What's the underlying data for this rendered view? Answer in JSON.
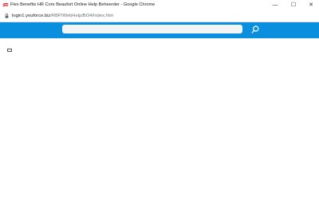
{
  "window": {
    "title": "Flex Benefits HR Core Beaufort Online Help Beheerder - Google Chrome",
    "app_icon": "brand-logo-icon",
    "controls": {
      "minimize_icon": "minimize-icon",
      "maximize_icon": "maximize-icon",
      "close_icon": "close-icon",
      "minimize_glyph": "—",
      "maximize_glyph": "☐",
      "close_glyph": "✕"
    }
  },
  "addressbar": {
    "lock_icon": "lock-icon",
    "url_host": "login1.youforce.biz",
    "url_path": "/RBP/WebHelp/BO4/index.htm"
  },
  "header": {
    "background_color": "#0a8fdf",
    "search": {
      "value": "",
      "placeholder": ""
    },
    "search_button_icon": "search-icon"
  },
  "content": {
    "toggle_icon": "toc-toggle-icon"
  }
}
